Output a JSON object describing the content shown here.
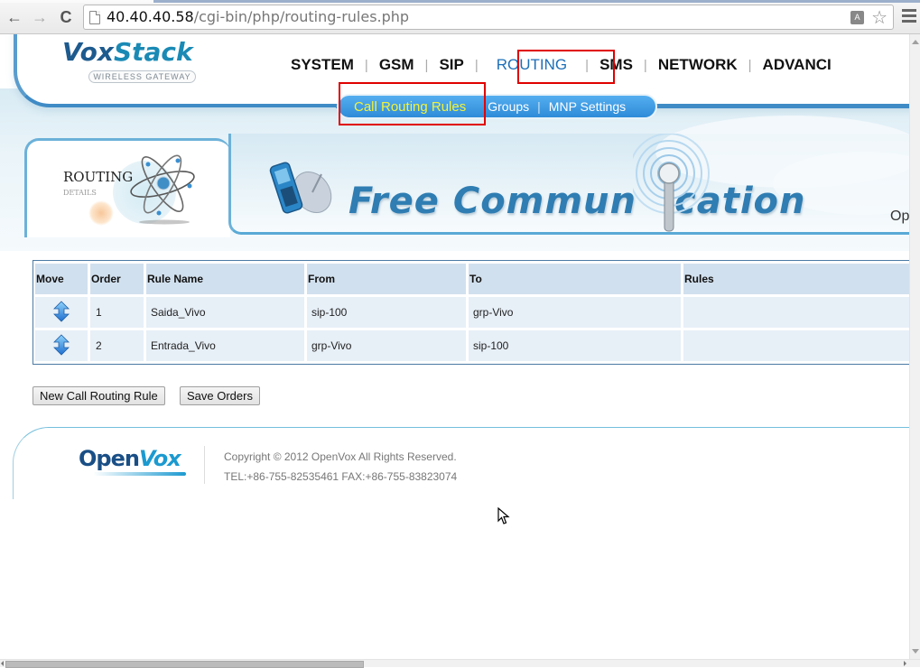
{
  "browser": {
    "url_host": "40.40.40.58",
    "url_path": "/cgi-bin/php/routing-rules.php",
    "back_label": "←",
    "forward_label": "→",
    "reload_label": "C"
  },
  "header": {
    "logo_part1": "Vox",
    "logo_part2": "Stack",
    "logo_tagline": "WIRELESS GATEWAY",
    "nav": [
      {
        "label": "SYSTEM"
      },
      {
        "label": "GSM"
      },
      {
        "label": "SIP"
      },
      {
        "label": "ROUTING",
        "active": true
      },
      {
        "label": "SMS"
      },
      {
        "label": "NETWORK"
      },
      {
        "label": "ADVANCI"
      }
    ],
    "subnav": [
      {
        "label": "Call Routing Rules",
        "active": true
      },
      {
        "label": "Groups"
      },
      {
        "label": "MNP Settings"
      }
    ]
  },
  "banner": {
    "section_title": "ROUTING",
    "section_subtitle": "DETAILS",
    "slogan_part1": "Free Commun",
    "slogan_part2": "cation",
    "right_text": "Op"
  },
  "table": {
    "headers": [
      "Move",
      "Order",
      "Rule Name",
      "From",
      "To",
      "Rules"
    ],
    "rows": [
      {
        "order": "1",
        "name": "Saida_Vivo",
        "from": "sip-100",
        "to": "grp-Vivo",
        "rules": ""
      },
      {
        "order": "2",
        "name": "Entrada_Vivo",
        "from": "grp-Vivo",
        "to": "sip-100",
        "rules": ""
      }
    ]
  },
  "buttons": {
    "new_rule": "New Call Routing Rule",
    "save_orders": "Save Orders"
  },
  "footer": {
    "logo_part1": "Open",
    "logo_part2": "Vox",
    "copyright": "Copyright © 2012 OpenVox All Rights Reserved.",
    "contact": "TEL:+86-755-82535461 FAX:+86-755-83823074"
  },
  "colors": {
    "accent_blue": "#1d6fb8",
    "active_subnav": "#f3f33a",
    "highlight_red": "#e00000",
    "table_header": "#d1e0ee",
    "table_cell": "#e7eff7"
  }
}
